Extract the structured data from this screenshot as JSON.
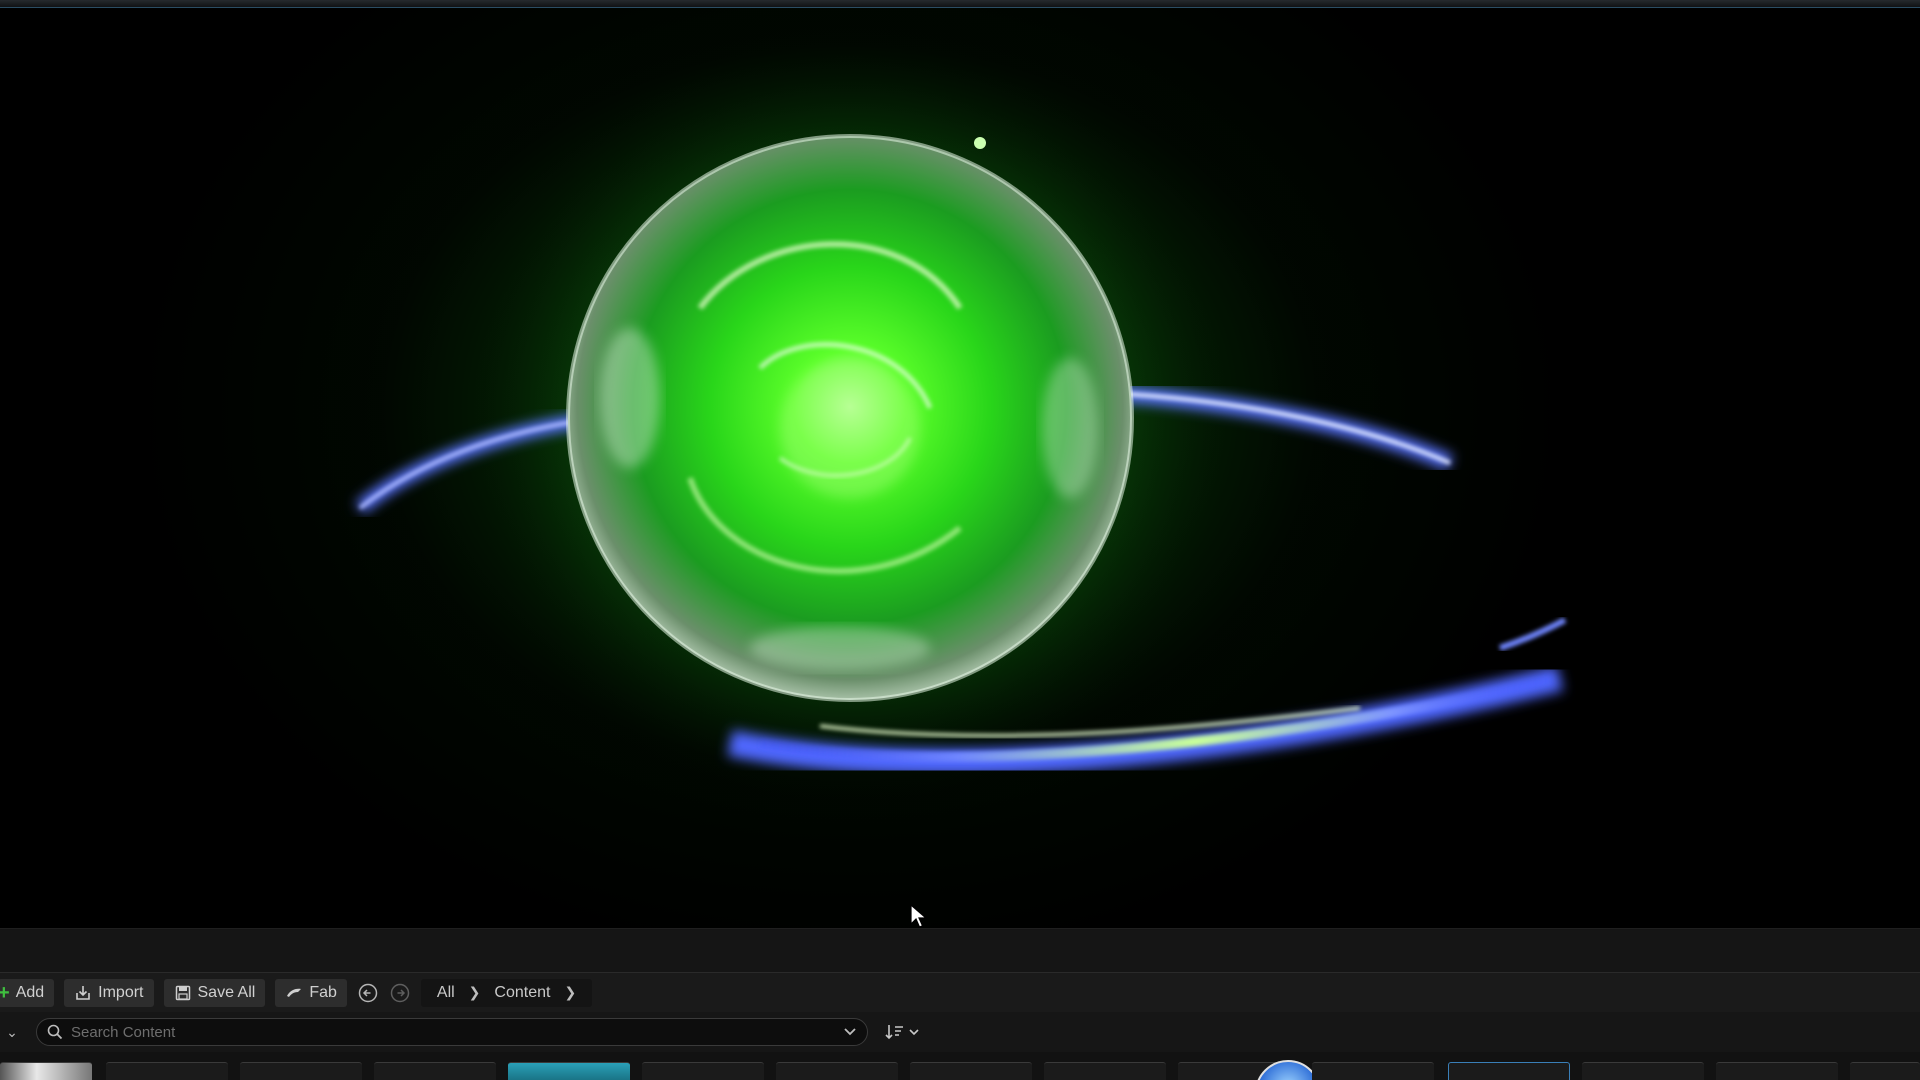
{
  "toolbar": {
    "add_label": "Add",
    "import_label": "Import",
    "save_all_label": "Save All",
    "fab_label": "Fab"
  },
  "breadcrumb": {
    "items": [
      "All",
      "Content"
    ]
  },
  "search": {
    "placeholder": "Search Content",
    "value": ""
  },
  "icons": {
    "add": "plus-icon",
    "import": "import-icon",
    "save_all": "save-icon",
    "fab": "fab-icon",
    "back": "back-arrow-icon",
    "forward": "forward-arrow-icon",
    "search": "search-icon",
    "sort": "sort-icon",
    "dropdown": "chevron-down-icon",
    "cursor": "mouse-cursor-icon"
  },
  "colors": {
    "orb_core": "#4cff2a",
    "orb_glow": "#1a9a1a",
    "ring": "#5a74ff",
    "background": "#000000",
    "panel": "#1a1a1a",
    "add_accent": "#3fbf3f"
  }
}
